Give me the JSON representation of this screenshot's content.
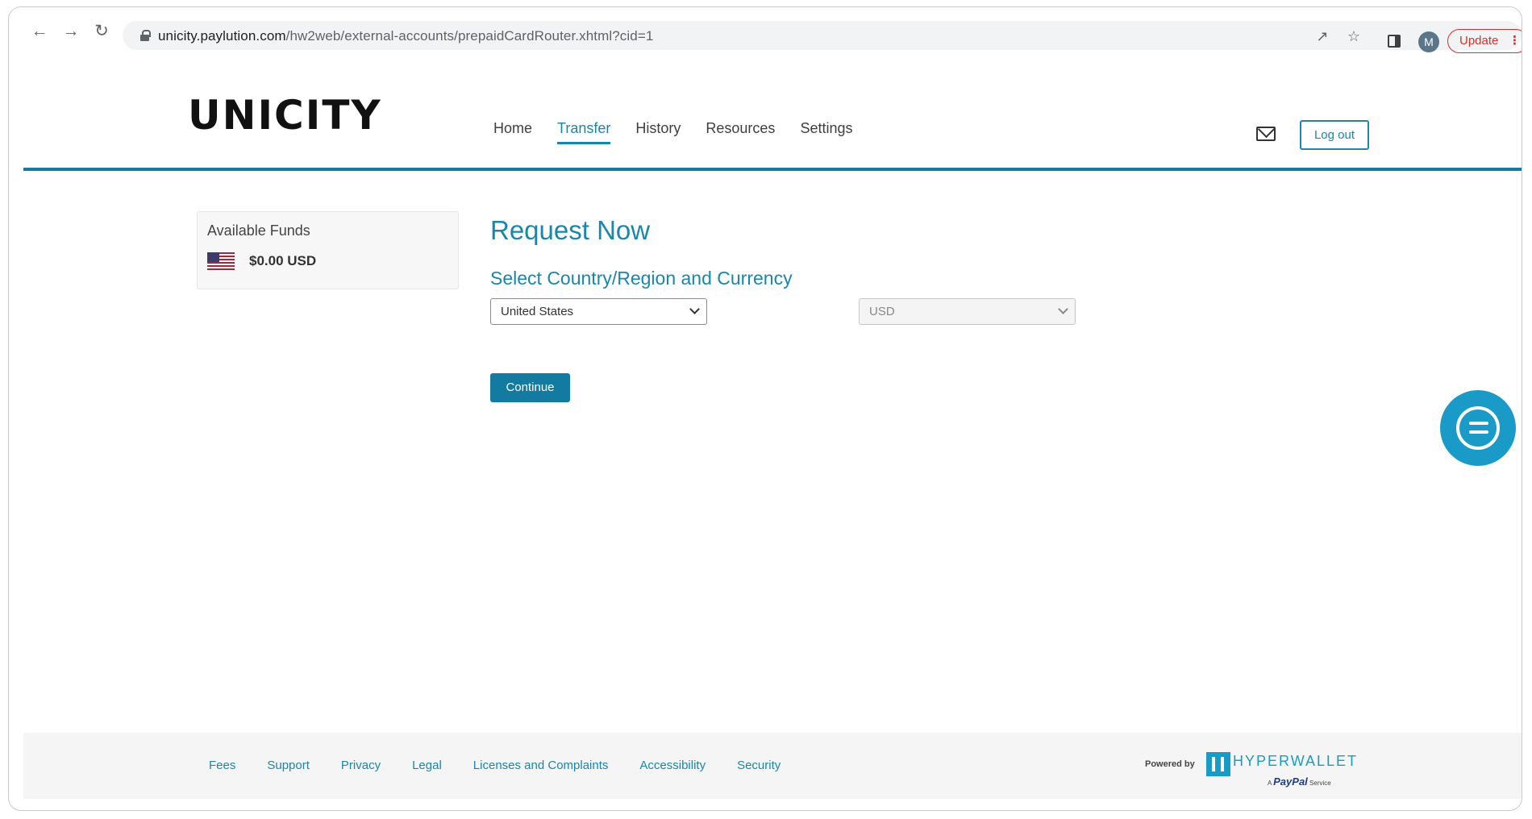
{
  "browser": {
    "url_host": "unicity.paylution.com",
    "url_path": "/hw2web/external-accounts/prepaidCardRouter.xhtml?cid=1",
    "profile_initial": "M",
    "update_label": "Update"
  },
  "header": {
    "logo": "UNICITY",
    "nav": [
      "Home",
      "Transfer",
      "History",
      "Resources",
      "Settings"
    ],
    "active_nav": "Transfer",
    "logout_label": "Log out"
  },
  "funds": {
    "title": "Available Funds",
    "amount": "$0.00 USD"
  },
  "form": {
    "title": "Request Now",
    "subtitle": "Select Country/Region and Currency",
    "country_value": "United States",
    "currency_value": "USD",
    "continue_label": "Continue"
  },
  "footer": {
    "links": [
      "Fees",
      "Support",
      "Privacy",
      "Legal",
      "Licenses and Complaints",
      "Accessibility",
      "Security"
    ],
    "powered_by": "Powered by",
    "brand": "HYPERWALLET",
    "tagline_prefix": "A",
    "tagline_brand": "PayPal",
    "tagline_suffix": "Service"
  },
  "colors": {
    "accent": "#137aa2",
    "link": "#1a86ac",
    "chat": "#1a9bc7",
    "update": "#d93025"
  },
  "icons": [
    "back-arrow-icon",
    "forward-arrow-icon",
    "reload-icon",
    "lock-icon",
    "share-icon",
    "star-icon",
    "sidebar-icon",
    "mail-icon",
    "chat-icon",
    "us-flag-icon"
  ]
}
